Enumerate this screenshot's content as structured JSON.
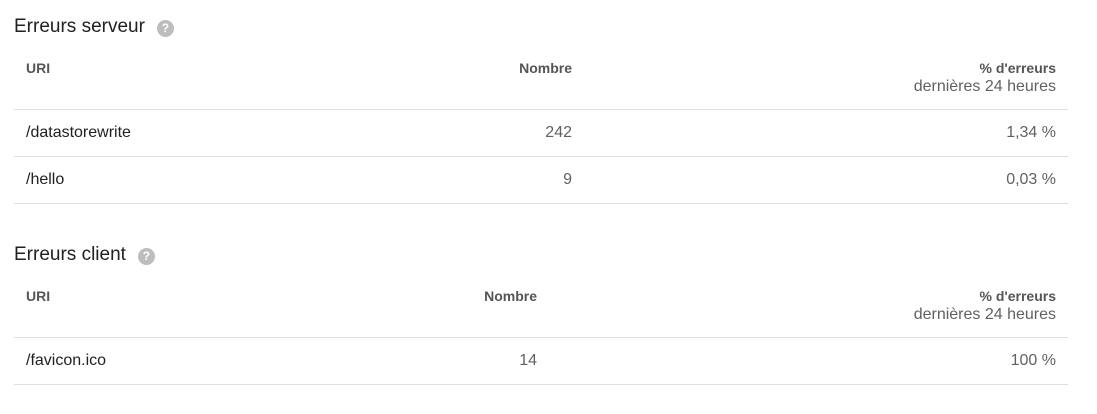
{
  "server_errors": {
    "title": "Erreurs serveur",
    "help_icon": "?",
    "columns": {
      "uri": "URI",
      "count": "Nombre",
      "percent": "% d'erreurs",
      "percent_sub": "dernières 24 heures"
    },
    "rows": [
      {
        "uri": "/datastorewrite",
        "count": "242",
        "percent": "1,34 %"
      },
      {
        "uri": "/hello",
        "count": "9",
        "percent": "0,03 %"
      }
    ]
  },
  "client_errors": {
    "title": "Erreurs client",
    "help_icon": "?",
    "columns": {
      "uri": "URI",
      "count": "Nombre",
      "percent": "% d'erreurs",
      "percent_sub": "dernières 24 heures"
    },
    "rows": [
      {
        "uri": "/favicon.ico",
        "count": "14",
        "percent": "100 %"
      }
    ]
  }
}
